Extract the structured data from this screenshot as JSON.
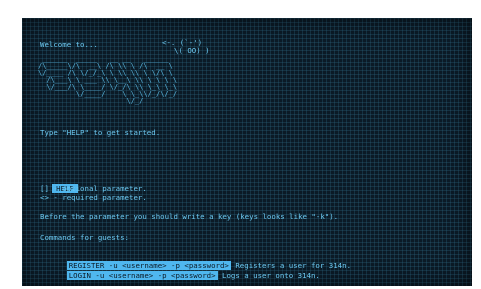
{
  "welcome": "Welcome to...",
  "face_line1": "<-. (`-')",
  "face_line2": "\\( OO) )",
  "logo_art": " ______  _____   __ __   ______\n/\\_____\\/\\  __\\ /\\ \\\\ \\ /\\  __ \\\n\\/____ /\\ \\/_/_\\ \\ \\\\ \\\\ \\ \\/\\ \\\n  /\\___\\ \\ ___ \\\\ \\__\\ \\\\ \\ \\ \\ \\\n  \\/___/\\ \\____/ \\/_/\\ \\\\ \\_\\ \\_\\\n         \\/____/    \\ \\_\\\\/_/\\/_/\n                     \\/_/",
  "type_help": "Type \"HELP\" to get started.",
  "help_badge": "HELP",
  "optional_line": "[] - optional parameter.",
  "required_line": "<> - required parameter.",
  "before_param": "Before the parameter you should write a key (keys looks like \"-k\").",
  "commands_title": "Commands for guests:",
  "commands": [
    {
      "cmd": "REGISTER -u <username> -p <password>",
      "desc": " Registers a user for 314n."
    },
    {
      "cmd": "LOGIN -u <username> -p <password>",
      "desc": " Logs a user onto 314n."
    }
  ]
}
